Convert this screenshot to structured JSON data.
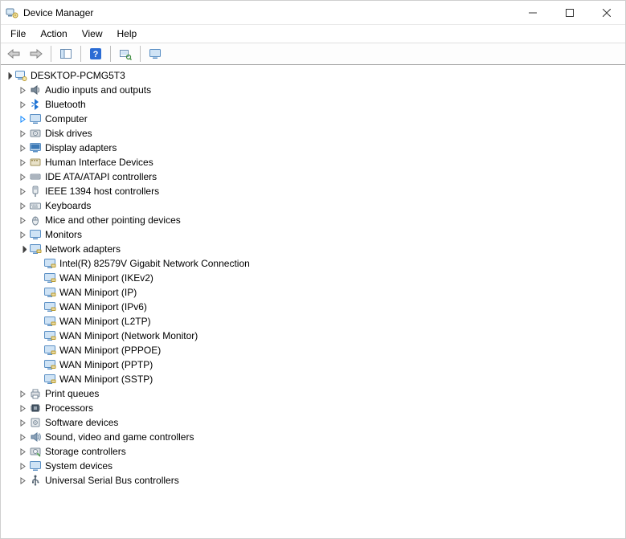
{
  "window": {
    "title": "Device Manager"
  },
  "menubar": {
    "file": "File",
    "action": "Action",
    "view": "View",
    "help": "Help"
  },
  "root": {
    "name": "DESKTOP-PCMG5T3"
  },
  "categories": [
    {
      "icon": "audio",
      "label": "Audio inputs and outputs"
    },
    {
      "icon": "bluetooth",
      "label": "Bluetooth"
    },
    {
      "icon": "computer",
      "label": "Computer",
      "highlightTwisty": true
    },
    {
      "icon": "disk",
      "label": "Disk drives"
    },
    {
      "icon": "display",
      "label": "Display adapters"
    },
    {
      "icon": "hid",
      "label": "Human Interface Devices"
    },
    {
      "icon": "ide",
      "label": "IDE ATA/ATAPI controllers"
    },
    {
      "icon": "ieee1394",
      "label": "IEEE 1394 host controllers"
    },
    {
      "icon": "keyboard",
      "label": "Keyboards"
    },
    {
      "icon": "mouse",
      "label": "Mice and other pointing devices"
    },
    {
      "icon": "monitor",
      "label": "Monitors"
    },
    {
      "icon": "network",
      "label": "Network adapters",
      "expanded": true,
      "children": [
        "Intel(R) 82579V Gigabit Network Connection",
        "WAN Miniport (IKEv2)",
        "WAN Miniport (IP)",
        "WAN Miniport (IPv6)",
        "WAN Miniport (L2TP)",
        "WAN Miniport (Network Monitor)",
        "WAN Miniport (PPPOE)",
        "WAN Miniport (PPTP)",
        "WAN Miniport (SSTP)"
      ]
    },
    {
      "icon": "printer",
      "label": "Print queues"
    },
    {
      "icon": "cpu",
      "label": "Processors"
    },
    {
      "icon": "software",
      "label": "Software devices"
    },
    {
      "icon": "sound",
      "label": "Sound, video and game controllers"
    },
    {
      "icon": "storage",
      "label": "Storage controllers"
    },
    {
      "icon": "system",
      "label": "System devices"
    },
    {
      "icon": "usb",
      "label": "Universal Serial Bus controllers"
    }
  ]
}
